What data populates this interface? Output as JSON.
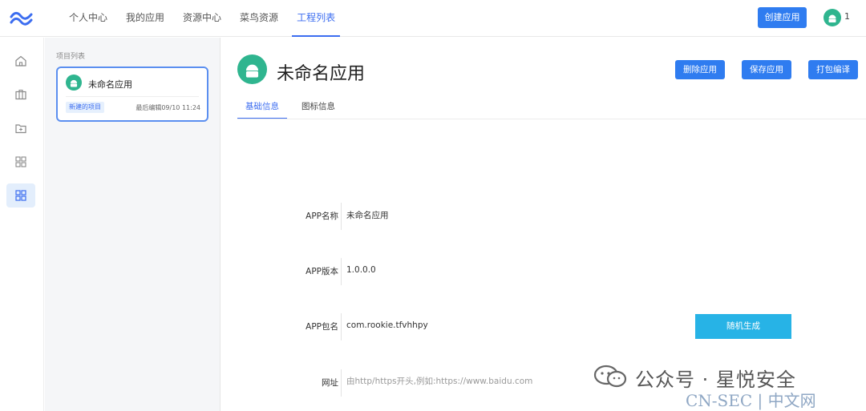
{
  "nav": {
    "items": [
      {
        "label": "个人中心"
      },
      {
        "label": "我的应用"
      },
      {
        "label": "资源中心"
      },
      {
        "label": "菜鸟资源"
      },
      {
        "label": "工程列表"
      }
    ],
    "active": "工程列表",
    "create_label": "创建应用",
    "user_count": "1"
  },
  "rail": {
    "icons": [
      "home-icon",
      "briefcase-icon",
      "folder-plus-icon",
      "grid-icon",
      "grid-icon"
    ],
    "active_index": 4
  },
  "projects": {
    "title": "项目列表",
    "items": [
      {
        "name": "未命名应用",
        "tag": "新建的项目",
        "time": "最后编辑09/10 11:24"
      }
    ]
  },
  "main": {
    "app_name": "未命名应用",
    "buttons": {
      "delete": "删除应用",
      "save": "保存应用",
      "build": "打包编译"
    },
    "tabs": [
      {
        "label": "基础信息"
      },
      {
        "label": "图标信息"
      }
    ],
    "active_tab": "基础信息",
    "form": {
      "name": {
        "label": "APP名称",
        "value": "未命名应用"
      },
      "version": {
        "label": "APP版本",
        "value": "1.0.0.0"
      },
      "package": {
        "label": "APP包名",
        "value": "com.rookie.tfvhhpy",
        "button": "随机生成"
      },
      "url": {
        "label": "网址",
        "placeholder": "由http/https开头,例如:https://www.baidu.com"
      }
    }
  },
  "watermark": {
    "text": "公众号 · 星悦安全",
    "sub": "CN-SEC | 中文网"
  },
  "colors": {
    "primary": "#2f7cf0",
    "accent": "#27b3e6",
    "android": "#2fb58f"
  }
}
